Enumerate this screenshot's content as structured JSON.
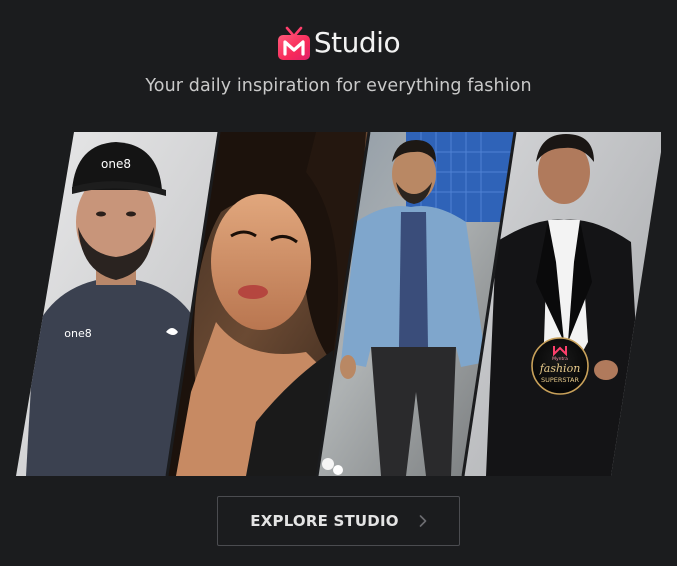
{
  "brand": {
    "logo_icon": "myntra-tv-icon",
    "name": "Studio",
    "accent_gradient": [
      "#ff3f6c",
      "#f7295a",
      "#e0206a"
    ]
  },
  "tagline": "Your daily inspiration for everything fashion",
  "collage": {
    "panels": [
      {
        "icon": "person-in-cap-photo",
        "cap_text": "one8",
        "shirt_text": "one8"
      },
      {
        "icon": "woman-portrait-photo"
      },
      {
        "icon": "man-in-denim-shirt-photo"
      },
      {
        "icon": "man-in-tuxedo-photo",
        "badge": {
          "top": "Myntra",
          "line1": "fashion",
          "line2": "SUPERSTAR"
        }
      }
    ]
  },
  "cta": {
    "label": "EXPLORE STUDIO",
    "icon": "chevron-right-icon"
  },
  "colors": {
    "background": "#1b1c1e",
    "button_border": "#4b4c50",
    "text": "#e6e6e6",
    "tagline": "#c9c9c9"
  }
}
